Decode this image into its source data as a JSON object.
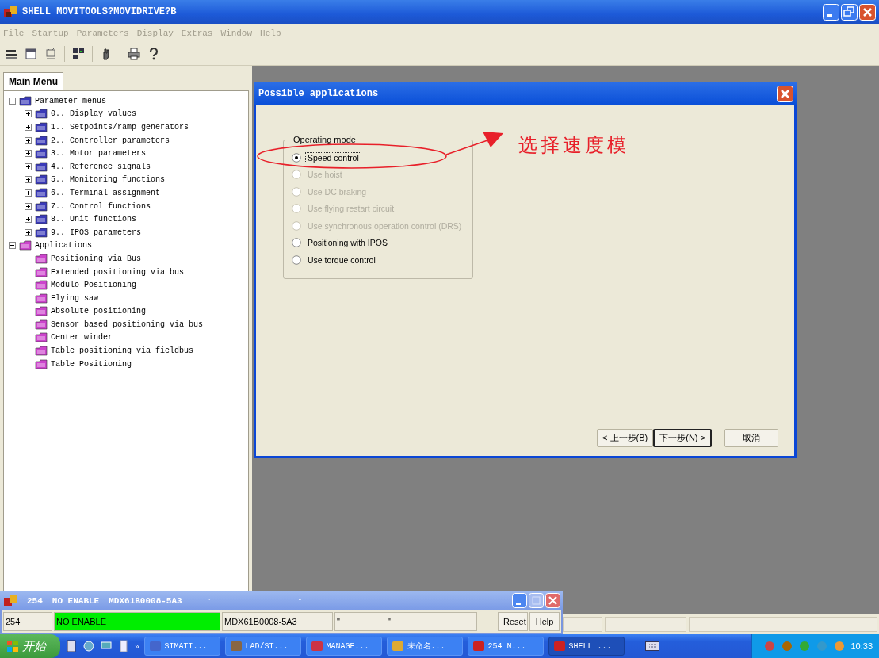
{
  "window": {
    "title": "SHELL  MOVITOOLS?MOVIDRIVE?B"
  },
  "menu": [
    "File",
    "Startup",
    "Parameters",
    "Display",
    "Extras",
    "Window",
    "Help"
  ],
  "main_menu": {
    "tab": "Main Menu",
    "tree": [
      {
        "label": "Parameter menus",
        "color": "#3a3ab8",
        "expanded": true,
        "children": [
          {
            "label": "0.. Display values",
            "color": "#3a3ab8",
            "expanded": false
          },
          {
            "label": "1.. Setpoints/ramp generators",
            "color": "#3a3ab8",
            "expanded": false
          },
          {
            "label": "2.. Controller parameters",
            "color": "#3a3ab8",
            "expanded": false
          },
          {
            "label": "3.. Motor parameters",
            "color": "#3a3ab8",
            "expanded": false
          },
          {
            "label": "4.. Reference signals",
            "color": "#3a3ab8",
            "expanded": false
          },
          {
            "label": "5.. Monitoring functions",
            "color": "#3a3ab8",
            "expanded": false
          },
          {
            "label": "6.. Terminal assignment",
            "color": "#3a3ab8",
            "expanded": false
          },
          {
            "label": "7.. Control functions",
            "color": "#3a3ab8",
            "expanded": false
          },
          {
            "label": "8.. Unit functions",
            "color": "#3a3ab8",
            "expanded": false
          },
          {
            "label": "9.. IPOS parameters",
            "color": "#3a3ab8",
            "expanded": false
          }
        ]
      },
      {
        "label": "Applications",
        "color": "#cc44cc",
        "expanded": true,
        "children": [
          {
            "label": "Positioning via Bus",
            "color": "#cc44cc"
          },
          {
            "label": "Extended positioning via bus",
            "color": "#cc44cc"
          },
          {
            "label": "Modulo Positioning",
            "color": "#cc44cc"
          },
          {
            "label": "Flying saw",
            "color": "#cc44cc"
          },
          {
            "label": "Absolute positioning",
            "color": "#cc44cc"
          },
          {
            "label": "Sensor based positioning via bus",
            "color": "#cc44cc"
          },
          {
            "label": "Center winder",
            "color": "#cc44cc"
          },
          {
            "label": "Table positioning via fieldbus",
            "color": "#cc44cc"
          },
          {
            "label": "Table Positioning",
            "color": "#cc44cc"
          }
        ]
      }
    ]
  },
  "dialog": {
    "title": "Possible applications",
    "group": "Operating mode",
    "options": [
      {
        "label": "Speed control",
        "selected": true,
        "disabled": false
      },
      {
        "label": "Use hoist",
        "selected": false,
        "disabled": true
      },
      {
        "label": "Use DC braking",
        "selected": false,
        "disabled": true
      },
      {
        "label": "Use flying restart circuit",
        "selected": false,
        "disabled": true
      },
      {
        "label": "Use synchronous operation control (DRS)",
        "selected": false,
        "disabled": true
      },
      {
        "label": "Positioning with IPOS",
        "selected": false,
        "disabled": false
      },
      {
        "label": "Use torque control",
        "selected": false,
        "disabled": false
      }
    ],
    "annotation": "选择速度模",
    "buttons": [
      {
        "label": "< 上一步(B)",
        "default": false
      },
      {
        "label": "下一步(N) >",
        "default": true
      },
      {
        "label": "取消",
        "default": false
      }
    ]
  },
  "status_window": {
    "title": [
      "254",
      "NO ENABLE",
      "MDX61B0008-5A3",
      "\"",
      "\""
    ],
    "fields": [
      {
        "text": "254"
      },
      {
        "text": "NO ENABLE",
        "color": "#00ee00"
      },
      {
        "text": "MDX61B0008-5A3"
      },
      {
        "text": "\"",
        "text_2": "\""
      }
    ],
    "buttons": [
      "Reset",
      "Help"
    ]
  },
  "taskbar": {
    "start": "开始",
    "more": "»",
    "tasks": [
      {
        "label": "SIMATI...",
        "selected": false
      },
      {
        "label": "LAD/ST...",
        "selected": false
      },
      {
        "label": "MANAGE...",
        "selected": false
      },
      {
        "label": "未命名...",
        "selected": false
      },
      {
        "label": "254 N...",
        "selected": false
      },
      {
        "label": "SHELL ...",
        "selected": true
      }
    ],
    "clock": "10:33"
  }
}
